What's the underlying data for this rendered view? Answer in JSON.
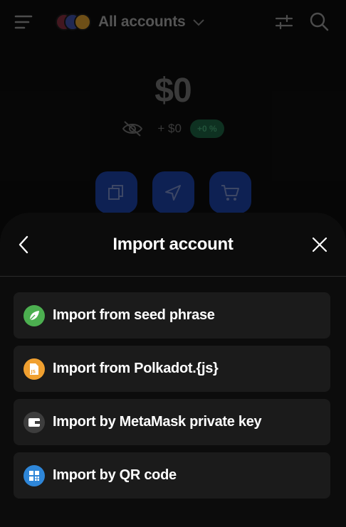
{
  "header": {
    "account_title": "All accounts"
  },
  "portfolio": {
    "balance": "$0",
    "change": "+ $0",
    "change_pct": "+0 %"
  },
  "sheet": {
    "title": "Import account",
    "options": [
      {
        "label": "Import from seed phrase",
        "icon": "leaf-icon",
        "color": "#4caf50"
      },
      {
        "label": "Import from Polkadot.{js}",
        "icon": "js-file-icon",
        "color": "#f0a030"
      },
      {
        "label": "Import by MetaMask private key",
        "icon": "wallet-icon",
        "color": "#3d3d3d"
      },
      {
        "label": "Import by QR code",
        "icon": "qr-code-icon",
        "color": "#2e86d8"
      }
    ]
  },
  "colors": {
    "background": "#0c0c0c",
    "card": "#1b1b1b",
    "accent_blue": "#1b3d98",
    "positive_bg": "#1b5a3c"
  }
}
